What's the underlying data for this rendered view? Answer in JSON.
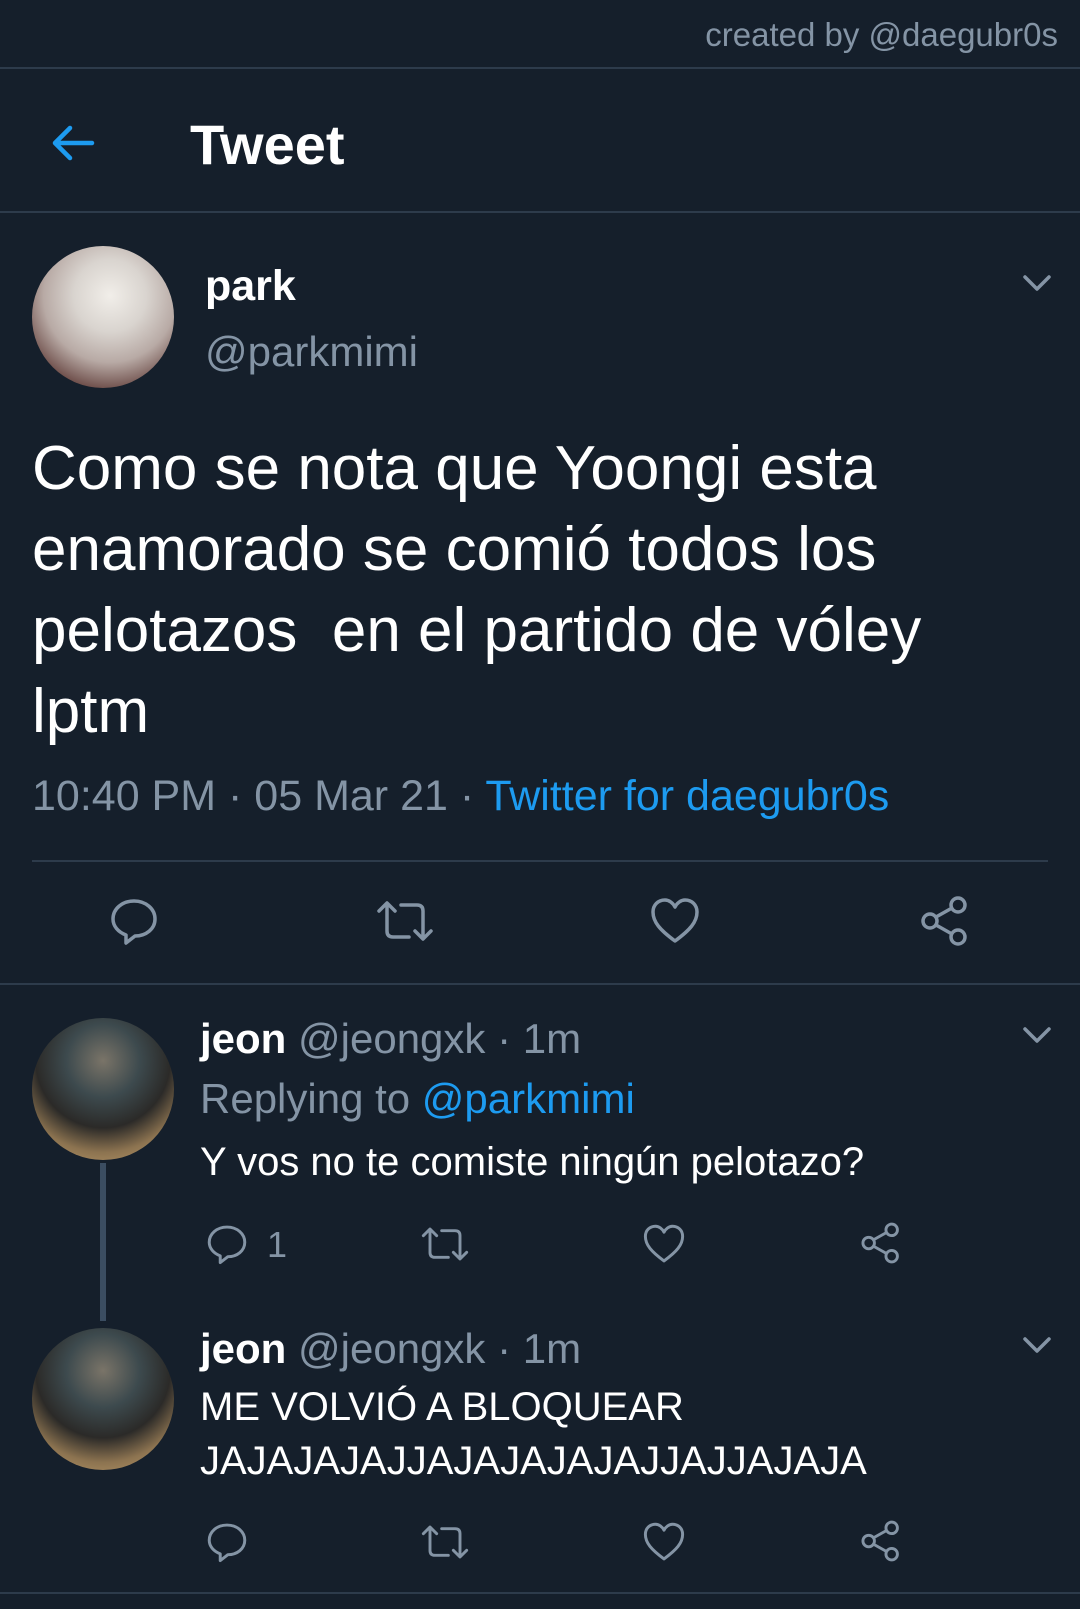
{
  "credit": "created by @daegubr0s",
  "header": {
    "title": "Tweet"
  },
  "tweet": {
    "name": "park",
    "handle": "@parkmimi",
    "text_lines": [
      "Como se nota que Yoongi esta",
      "enamorado se comió todos los",
      "pelotazos  en el partido de vóley",
      "lptm"
    ],
    "time": "10:40 PM",
    "date": "05 Mar 21",
    "separator": "·",
    "source": "Twitter for daegubr0s"
  },
  "replies": [
    {
      "name": "jeon",
      "handle": "@jeongxk",
      "age": "· 1m",
      "replying_prefix": "Replying to",
      "replying_to": "@parkmimi",
      "text_lines": [
        "Y vos no te comiste ningún pelotazo?"
      ],
      "reply_count": "1"
    },
    {
      "name": "jeon",
      "handle": "@jeongxk",
      "age": "· 1m",
      "text_lines": [
        "ME VOLVIÓ A BLOQUEAR",
        "JAJAJAJAJJAJAJAJAJAJJAJJAJAJA"
      ]
    }
  ],
  "icons": {
    "back": "back-arrow-icon",
    "menu": "chevron-down-icon",
    "reply": "reply-icon",
    "retweet": "retweet-icon",
    "like": "heart-icon",
    "share": "share-icon"
  },
  "colors": {
    "background": "#151f2b",
    "accent": "#1d9bf0",
    "secondary_text": "#8494a5",
    "divider": "#2d3b4b"
  }
}
